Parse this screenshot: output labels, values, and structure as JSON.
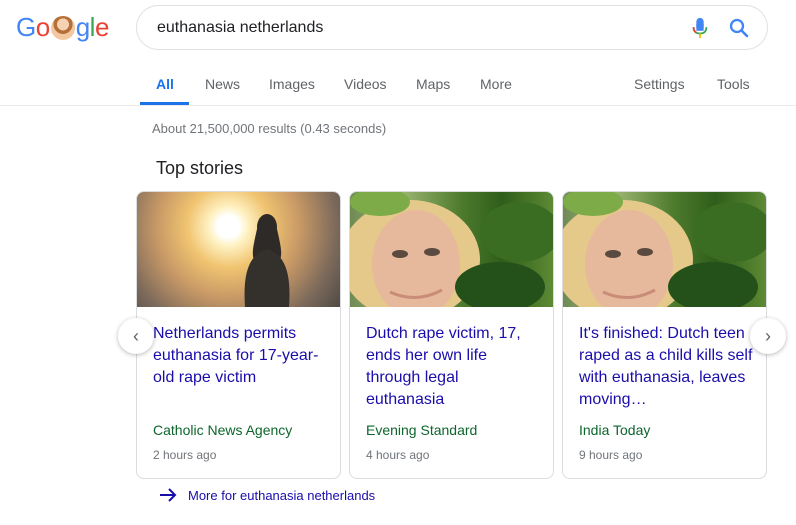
{
  "logo": {
    "g1": "G",
    "o1": "o",
    "g2": "g",
    "l": "l",
    "e": "e"
  },
  "search": {
    "query": "euthanasia netherlands",
    "mic_icon": "mic-icon",
    "search_icon": "search-icon"
  },
  "tabs": [
    {
      "label": "All",
      "active": true
    },
    {
      "label": "News"
    },
    {
      "label": "Images"
    },
    {
      "label": "Videos"
    },
    {
      "label": "Maps"
    },
    {
      "label": "More"
    }
  ],
  "tools": {
    "settings": "Settings",
    "tools": "Tools"
  },
  "stats": "About 21,500,000 results (0.43 seconds)",
  "section_title": "Top stories",
  "stories": [
    {
      "headline": "Netherlands permits euthanasia for 17-year-old rape victim",
      "source": "Catholic News Agency",
      "time": "2 hours ago"
    },
    {
      "headline": "Dutch rape victim, 17, ends her own life through legal euthanasia",
      "source": "Evening Standard",
      "time": "4 hours ago"
    },
    {
      "headline": "It's finished: Dutch teen raped as a child kills self with euthanasia, leaves moving…",
      "source": "India Today",
      "time": "9 hours ago"
    }
  ],
  "nav": {
    "prev": "‹",
    "next": "›"
  },
  "more_link": {
    "arrow": "→",
    "text": "More for euthanasia netherlands"
  },
  "colors": {
    "link": "#1a0dab",
    "source": "#0d652d",
    "accent": "#1a73e8"
  }
}
